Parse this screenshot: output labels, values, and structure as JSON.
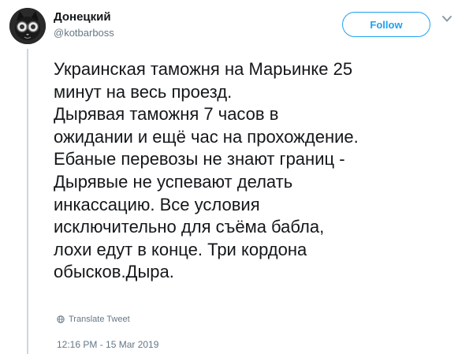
{
  "author": {
    "display_name": "Донецкий",
    "username": "@kotbarboss"
  },
  "follow_button": {
    "label": "Follow"
  },
  "tweet": {
    "lines": [
      "Украинская таможня на Марьинке 25",
      "минут на весь проезд.",
      "Дырявая таможня 7 часов в",
      "ожидании и ещё час на прохождение.",
      "Ебаные перевозы не знают границ -",
      "Дырявые не успевают делать",
      "инкассацию.  Все условия",
      "исключительно для съёма бабла,",
      "лохи едут в конце. Три кордона",
      "обысков.Дыра."
    ]
  },
  "translate": {
    "label": "Translate Tweet"
  },
  "timestamp": "12:16 PM - 15 Mar 2019",
  "colors": {
    "accent": "#1da1f2",
    "text": "#14171a",
    "secondary_text": "#657786",
    "thread_line": "#ccd6dd"
  },
  "icons": {
    "avatar": "cat-with-goggles-avatar",
    "caret": "chevron-down-icon",
    "translate": "globe-icon"
  }
}
